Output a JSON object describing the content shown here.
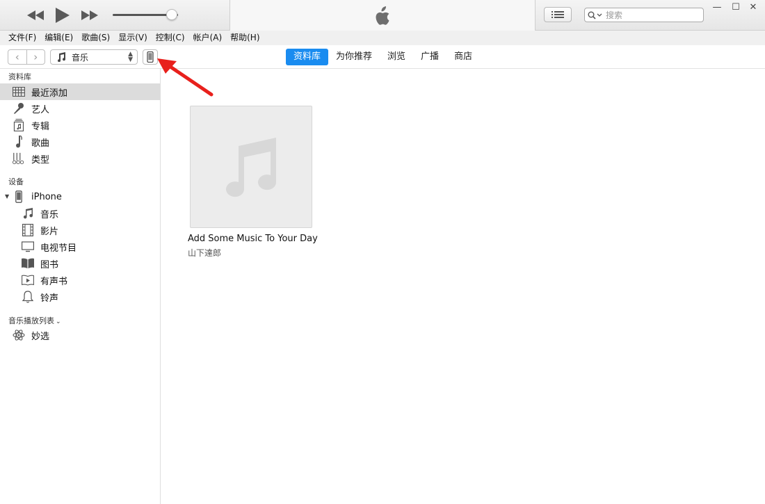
{
  "player": {
    "volume_level": 0.9
  },
  "search": {
    "placeholder": "搜索"
  },
  "window_controls": {
    "minimize": "—",
    "maximize": "☐",
    "close": "✕"
  },
  "menubar": {
    "items": [
      "文件(F)",
      "编辑(E)",
      "歌曲(S)",
      "显示(V)",
      "控制(C)",
      "帐户(A)",
      "帮助(H)"
    ]
  },
  "toolbar": {
    "back": "‹",
    "forward": "›",
    "media_kind": "音乐",
    "tabs": [
      "资料库",
      "为你推荐",
      "浏览",
      "广播",
      "商店"
    ],
    "active_tab": "资料库"
  },
  "sidebar": {
    "library_header": "资料库",
    "library_items": [
      {
        "label": "最近添加",
        "icon": "grid-icon"
      },
      {
        "label": "艺人",
        "icon": "microphone-icon"
      },
      {
        "label": "专辑",
        "icon": "album-icon"
      },
      {
        "label": "歌曲",
        "icon": "music-note-icon"
      },
      {
        "label": "类型",
        "icon": "genre-icon"
      }
    ],
    "devices_header": "设备",
    "device_name": "iPhone",
    "device_items": [
      {
        "label": "音乐",
        "icon": "music-note-icon"
      },
      {
        "label": "影片",
        "icon": "film-icon"
      },
      {
        "label": "电视节目",
        "icon": "tv-icon"
      },
      {
        "label": "图书",
        "icon": "book-icon"
      },
      {
        "label": "有声书",
        "icon": "audiobook-icon"
      },
      {
        "label": "铃声",
        "icon": "bell-icon"
      }
    ],
    "playlists_header": "音乐播放列表",
    "playlist_items": [
      {
        "label": "妙选",
        "icon": "atom-icon"
      }
    ]
  },
  "main": {
    "album": {
      "title": "Add Some Music To Your Day",
      "artist": "山下達郎"
    }
  },
  "colors": {
    "accent": "#1a8cf0",
    "annotation_arrow": "#e8201c"
  }
}
